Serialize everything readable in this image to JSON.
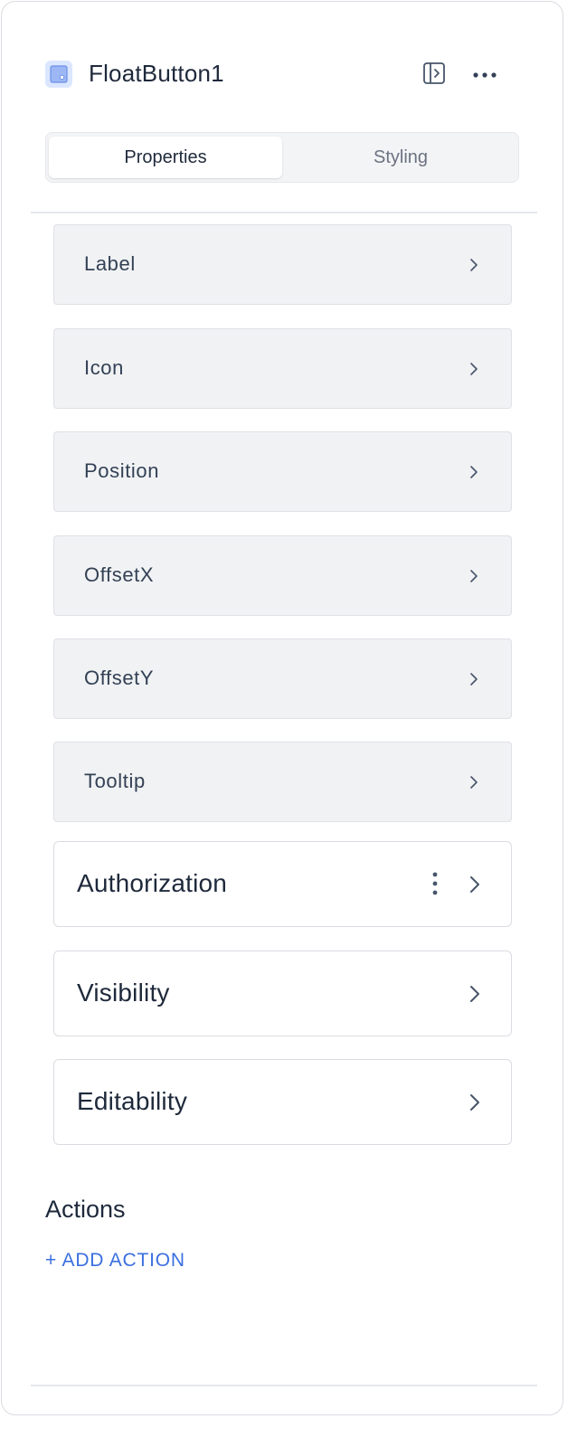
{
  "header": {
    "component_name": "FloatButton1",
    "component_icon": "float-button-icon",
    "toggle_panel_icon": "panel-toggle-icon",
    "more_icon": "more-horizontal-icon"
  },
  "tabs": [
    {
      "label": "Properties",
      "active": true
    },
    {
      "label": "Styling",
      "active": false
    }
  ],
  "properties": [
    {
      "label": "Label"
    },
    {
      "label": "Icon"
    },
    {
      "label": "Position"
    },
    {
      "label": "OffsetX"
    },
    {
      "label": "OffsetY"
    },
    {
      "label": "Tooltip"
    }
  ],
  "sections": [
    {
      "label": "Authorization",
      "has_menu": true
    },
    {
      "label": "Visibility",
      "has_menu": false
    },
    {
      "label": "Editability",
      "has_menu": false
    }
  ],
  "actions": {
    "title": "Actions",
    "add_label": "+ ADD ACTION"
  },
  "colors": {
    "accent": "#3b6fe0",
    "row_bg": "#f1f2f4",
    "icon_bg": "#dbe6ff"
  }
}
